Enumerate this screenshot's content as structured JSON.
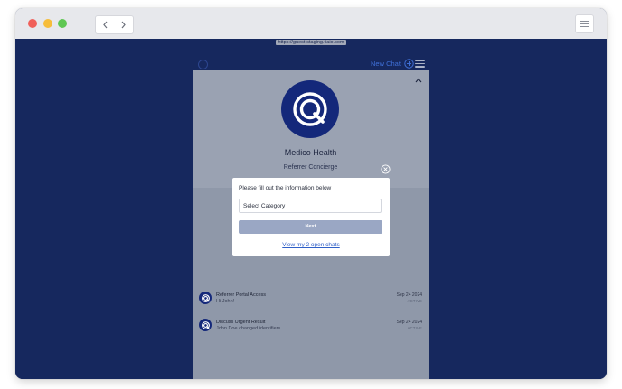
{
  "browser": {
    "url": "https://guest-staging.fiaio.com",
    "back_icon": "chevron-left-icon",
    "forward_icon": "chevron-right-icon",
    "menu_icon": "hamburger-icon"
  },
  "header": {
    "new_chat_label": "New Chat",
    "new_chat_icon": "plus-circle-icon",
    "menu_icon": "hamburger-icon"
  },
  "brand": {
    "name": "Medico Health",
    "subtitle": "Referrer Concierge",
    "logo_icon": "at-sign-logo-icon",
    "color": "#14287a"
  },
  "modal": {
    "title": "Please fill out the information below",
    "category_value": "Select Category",
    "next_label": "Next",
    "open_chats_link": "View my 2 open chats",
    "close_icon": "close-circle-icon"
  },
  "chats": [
    {
      "title": "Referrer Portal Access",
      "preview": "Hi John!",
      "date": "Sep 24 2024",
      "status": "ACTIVE"
    },
    {
      "title": "Discuss Urgent Result",
      "preview": "John Doe changed identifiers.",
      "date": "Sep 24 2024",
      "status": "ACTIVE"
    }
  ],
  "colors": {
    "background": "#16285e",
    "accent": "#3f6fd6",
    "overlay": "#8f98a9",
    "button_disabled": "#9aa7c4"
  }
}
